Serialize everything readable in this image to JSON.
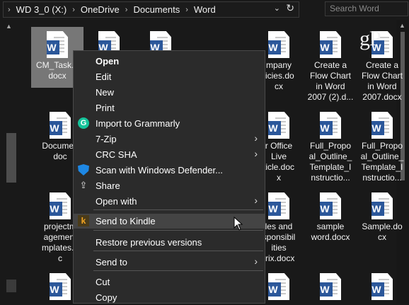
{
  "address_bar": {
    "crumbs": [
      "WD 3_0 (X:)",
      "OneDrive",
      "Documents",
      "Word"
    ],
    "separator": "›",
    "dropdown_glyph": "⌄",
    "refresh_glyph": "↻"
  },
  "search": {
    "placeholder": "Search Word"
  },
  "watermark": "gP",
  "files": [
    {
      "name": "CM_Task...\ndocx",
      "selected": true
    },
    {
      "name": "",
      "selected": false
    },
    {
      "name": "",
      "selected": false
    },
    {
      "name": "mpany\nlicies.do\ncx",
      "selected": false
    },
    {
      "name": "Create a\nFlow Chart\nin Word\n2007 (2).d...",
      "selected": false
    },
    {
      "name": "Create a\nFlow Chart\nin Word\n2007.docx",
      "selected": false
    },
    {
      "name": "Documen\ndoc",
      "selected": false
    },
    {
      "name": "r Office\nLive\nticle.doc\nx",
      "selected": false
    },
    {
      "name": "Full_Propo\nal_Outline_\nTemplate_I\nnstructio...",
      "selected": false
    },
    {
      "name": "Full_Propo\nal_Outline_\nTemplate_I\nnstructio...",
      "selected": false
    },
    {
      "name": "projectm\nagement\nmplates.d\nc",
      "selected": false
    },
    {
      "name": "les and\nsponsibil\nities\ntrix.docx",
      "selected": false
    },
    {
      "name": "sample\nword.docx",
      "selected": false
    },
    {
      "name": "Sample.do\ncx",
      "selected": false
    },
    {
      "name": "",
      "selected": false
    },
    {
      "name": "",
      "selected": false
    },
    {
      "name": "",
      "selected": false
    },
    {
      "name": "",
      "selected": false
    },
    {
      "name": "",
      "selected": false
    }
  ],
  "context_menu": {
    "items": [
      {
        "label": "Open",
        "bold": true
      },
      {
        "label": "Edit"
      },
      {
        "label": "New"
      },
      {
        "label": "Print"
      },
      {
        "label": "Import to Grammarly",
        "icon": "grammarly-icon"
      },
      {
        "label": "7-Zip",
        "submenu": true
      },
      {
        "label": "CRC SHA",
        "submenu": true
      },
      {
        "label": "Scan with Windows Defender...",
        "icon": "defender-shield-icon"
      },
      {
        "label": "Share",
        "icon": "share-icon"
      },
      {
        "label": "Open with",
        "submenu": true
      },
      {
        "label": "Send to Kindle",
        "icon": "kindle-icon",
        "highlighted": true
      },
      {
        "label": "Restore previous versions"
      },
      {
        "label": "Send to",
        "submenu": true
      },
      {
        "label": "Cut"
      },
      {
        "label": "Copy"
      }
    ],
    "submenu_glyph": "›"
  },
  "colors": {
    "background": "#191919",
    "menu_bg": "#2b2b2b",
    "word_blue": "#2b579a",
    "selected": "#777777",
    "highlight": "#444444"
  }
}
